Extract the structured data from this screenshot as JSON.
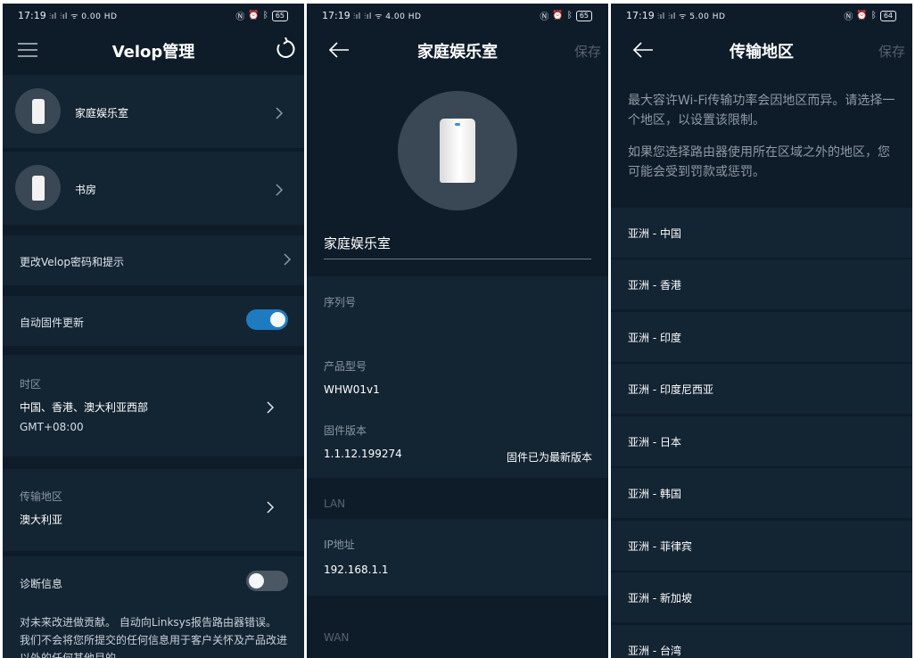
{
  "status": [
    {
      "time": "17:19",
      "net": "⫶ıl ⫶ıl ᯤ 0.00 HD",
      "battery": "65"
    },
    {
      "time": "17:19",
      "net": "⫶ıl ⫶ıl ᯤ 4.00 HD",
      "battery": "65"
    },
    {
      "time": "17:19",
      "net": "⫶ıl ⫶ıl ᯤ 5.00 HD",
      "battery": "64"
    }
  ],
  "screen1": {
    "title": "Velop管理",
    "nodes": [
      {
        "name": "家庭娱乐室"
      },
      {
        "name": "书房"
      }
    ],
    "change_password": "更改Velop密码和提示",
    "auto_update": {
      "label": "自动固件更新",
      "enabled": true
    },
    "timezone": {
      "label": "时区",
      "value": "中国、香港、澳大利亚西部",
      "offset": "GMT+08:00"
    },
    "region": {
      "label": "传输地区",
      "value": "澳大利亚"
    },
    "diagnostics": {
      "label": "诊断信息",
      "enabled": false,
      "description": "对未来改进做贡献。 自动向Linksys报告路由器错误。 我们不会将您所提交的任何信息用于客户关怀及产品改进以外的任何其他目的。"
    }
  },
  "screen2": {
    "title": "家庭娱乐室",
    "save_label": "保存",
    "node_name_value": "家庭娱乐室",
    "serial_label": "序列号",
    "serial_value": "",
    "model_label": "产品型号",
    "model_value": "WHW01v1",
    "firmware_label": "固件版本",
    "firmware_value": "1.1.12.199274",
    "firmware_status": "固件已为最新版本",
    "lan_header": "LAN",
    "ip_label": "IP地址",
    "ip_value": "192.168.1.1",
    "wan_header": "WAN"
  },
  "screen3": {
    "title": "传输地区",
    "save_label": "保存",
    "intro_1": "最大容许Wi-Fi传输功率会因地区而异。请选择一个地区，以设置该限制。",
    "intro_2": "如果您选择路由器使用所在区域之外的地区，您可能会受到罚款或惩罚。",
    "regions": [
      "亚洲 - 中国",
      "亚洲 - 香港",
      "亚洲 - 印度",
      "亚洲 - 印度尼西亚",
      "亚洲 - 日本",
      "亚洲 - 韩国",
      "亚洲 - 菲律宾",
      "亚洲 - 新加坡",
      "亚洲 - 台湾"
    ]
  },
  "colors": {
    "background": "#0e1c29",
    "card": "#132433",
    "accent": "#1f7bc0",
    "muted": "#8b97a2"
  }
}
